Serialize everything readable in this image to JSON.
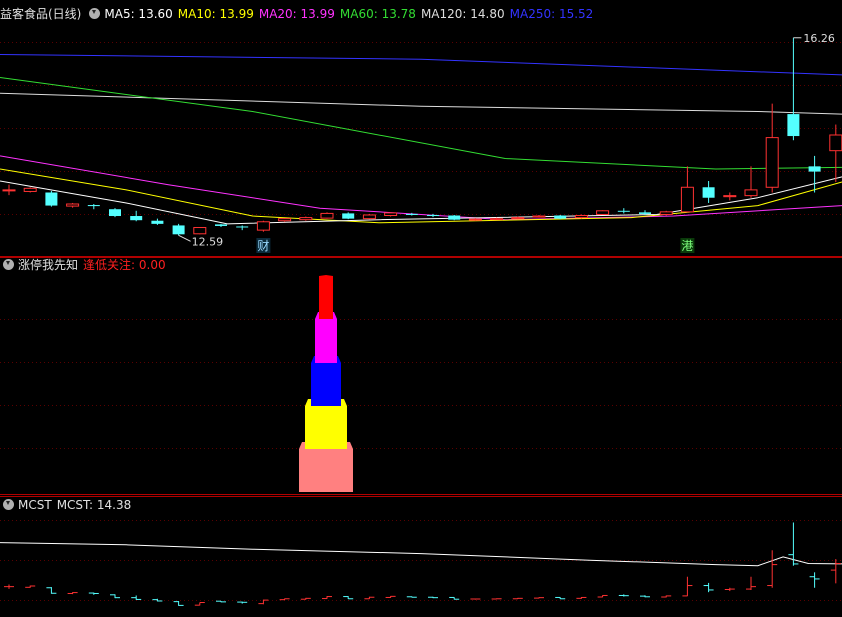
{
  "header": {
    "stock_name": "益客食品(日线)",
    "ma": [
      {
        "label": "MA5: 13.60",
        "color": "#ffffff"
      },
      {
        "label": "MA10: 13.99",
        "color": "#ffff00"
      },
      {
        "label": "MA20: 13.99",
        "color": "#ff33ff"
      },
      {
        "label": "MA60: 13.78",
        "color": "#33dd33"
      },
      {
        "label": "MA120: 14.80",
        "color": "#dddddd"
      },
      {
        "label": "MA250: 15.52",
        "color": "#3333ff"
      }
    ]
  },
  "indicator_panel": {
    "name": "涨停我先知",
    "label": "逢低关注: 0.00",
    "label_color": "#ff2020"
  },
  "mcst_panel": {
    "name": "MCST",
    "label": "MCST: 14.38"
  },
  "chart_data": {
    "type": "candlestick",
    "y_range_main": [
      12.2,
      16.6
    ],
    "annotations": {
      "high_label": "16.26",
      "low_label": "12.59",
      "marker_cai": "财",
      "marker_gang": "港"
    },
    "candles": [
      {
        "o": 13.35,
        "c": 13.35,
        "h": 13.45,
        "l": 13.25
      },
      {
        "o": 13.32,
        "c": 13.38,
        "h": 13.4,
        "l": 13.3
      },
      {
        "o": 13.3,
        "c": 13.05,
        "h": 13.33,
        "l": 13.03
      },
      {
        "o": 13.04,
        "c": 13.08,
        "h": 13.1,
        "l": 13.01
      },
      {
        "o": 13.06,
        "c": 13.04,
        "h": 13.08,
        "l": 12.98
      },
      {
        "o": 12.98,
        "c": 12.85,
        "h": 13.0,
        "l": 12.83
      },
      {
        "o": 12.85,
        "c": 12.77,
        "h": 12.95,
        "l": 12.75
      },
      {
        "o": 12.76,
        "c": 12.7,
        "h": 12.8,
        "l": 12.68
      },
      {
        "o": 12.67,
        "c": 12.5,
        "h": 12.7,
        "l": 12.48
      },
      {
        "o": 12.51,
        "c": 12.63,
        "h": 12.63,
        "l": 12.5
      },
      {
        "o": 12.69,
        "c": 12.66,
        "h": 12.7,
        "l": 12.64
      },
      {
        "o": 12.65,
        "c": 12.64,
        "h": 12.67,
        "l": 12.58
      },
      {
        "o": 12.58,
        "c": 12.74,
        "h": 12.76,
        "l": 12.55
      },
      {
        "o": 12.76,
        "c": 12.8,
        "h": 12.81,
        "l": 12.74
      },
      {
        "o": 12.78,
        "c": 12.82,
        "h": 12.84,
        "l": 12.76
      },
      {
        "o": 12.81,
        "c": 12.9,
        "h": 12.92,
        "l": 12.8
      },
      {
        "o": 12.9,
        "c": 12.8,
        "h": 12.92,
        "l": 12.79
      },
      {
        "o": 12.8,
        "c": 12.87,
        "h": 12.89,
        "l": 12.79
      },
      {
        "o": 12.86,
        "c": 12.91,
        "h": 12.92,
        "l": 12.84
      },
      {
        "o": 12.89,
        "c": 12.87,
        "h": 12.91,
        "l": 12.86
      },
      {
        "o": 12.87,
        "c": 12.85,
        "h": 12.89,
        "l": 12.83
      },
      {
        "o": 12.86,
        "c": 12.78,
        "h": 12.87,
        "l": 12.77
      },
      {
        "o": 12.79,
        "c": 12.79,
        "h": 12.81,
        "l": 12.76
      },
      {
        "o": 12.79,
        "c": 12.8,
        "h": 12.82,
        "l": 12.78
      },
      {
        "o": 12.8,
        "c": 12.82,
        "h": 12.84,
        "l": 12.79
      },
      {
        "o": 12.83,
        "c": 12.85,
        "h": 12.87,
        "l": 12.82
      },
      {
        "o": 12.86,
        "c": 12.8,
        "h": 12.87,
        "l": 12.79
      },
      {
        "o": 12.82,
        "c": 12.86,
        "h": 12.88,
        "l": 12.8
      },
      {
        "o": 12.88,
        "c": 12.95,
        "h": 12.96,
        "l": 12.87
      },
      {
        "o": 12.95,
        "c": 12.94,
        "h": 13.0,
        "l": 12.9
      },
      {
        "o": 12.92,
        "c": 12.89,
        "h": 12.96,
        "l": 12.87
      },
      {
        "o": 12.88,
        "c": 12.93,
        "h": 12.95,
        "l": 12.86
      },
      {
        "o": 12.93,
        "c": 13.4,
        "h": 13.8,
        "l": 12.92
      },
      {
        "o": 13.4,
        "c": 13.2,
        "h": 13.52,
        "l": 13.1
      },
      {
        "o": 13.22,
        "c": 13.24,
        "h": 13.3,
        "l": 13.15
      },
      {
        "o": 13.24,
        "c": 13.35,
        "h": 13.8,
        "l": 13.2
      },
      {
        "o": 13.4,
        "c": 14.35,
        "h": 15.0,
        "l": 13.3
      },
      {
        "o": 14.8,
        "c": 14.38,
        "h": 16.26,
        "l": 14.3
      },
      {
        "o": 13.8,
        "c": 13.7,
        "h": 14.0,
        "l": 13.3
      },
      {
        "o": 14.1,
        "c": 14.4,
        "h": 14.6,
        "l": 13.5
      }
    ],
    "ma_lines": [
      {
        "name": "MA250",
        "color": "#3333ff",
        "values": [
          15.94,
          15.55
        ]
      },
      {
        "name": "MA120",
        "color": "#dddddd",
        "values": [
          15.2,
          14.8
        ]
      },
      {
        "name": "MA60",
        "color": "#33dd33",
        "values": [
          15.5,
          13.78
        ]
      },
      {
        "name": "MA20",
        "color": "#ff33ff",
        "values": [
          14.0,
          13.05
        ]
      },
      {
        "name": "MA10",
        "color": "#ffff00",
        "values": [
          13.75,
          13.5
        ]
      },
      {
        "name": "MA5",
        "color": "#ffffff",
        "values": [
          13.52,
          13.6
        ]
      }
    ],
    "indicator_bars": [
      {
        "color": "#ff8080",
        "value": 1
      },
      {
        "color": "#ffff00",
        "value": 2
      },
      {
        "color": "#0000ff",
        "value": 3
      },
      {
        "color": "#ff00ff",
        "value": 4
      },
      {
        "color": "#ff0000",
        "value": 5
      }
    ],
    "mcst": {
      "value": 14.38,
      "color": "#ffffff"
    }
  }
}
